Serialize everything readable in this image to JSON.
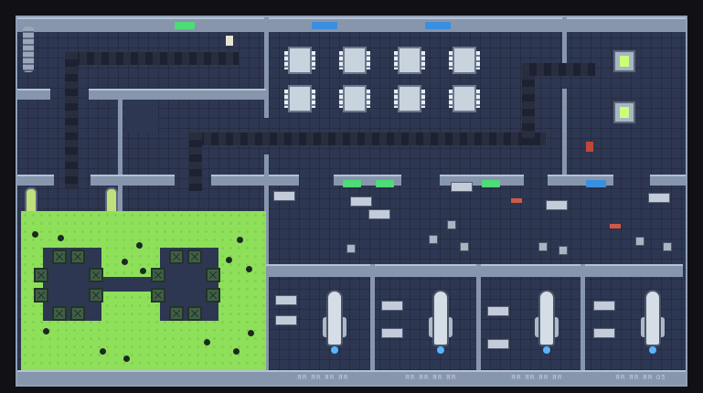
{
  "game": {
    "view": "top-down space station map",
    "signs": {
      "green_color": "#4ddc78",
      "blue_color": "#3a8fe0"
    },
    "bottom_labels": [
      "ЯR ЯR ЯR ЯR",
      "ЯR ЯR ЯR ЯR",
      "ЯR ЯR ЯR ЯR",
      "ЯR ЯR ЯR 05"
    ],
    "rooms": [
      "mess-hall",
      "corridor",
      "greenhouse",
      "office",
      "hangar-bay-1",
      "hangar-bay-2",
      "hangar-bay-3",
      "hangar-bay-4"
    ],
    "colors": {
      "floor": "#2e3752",
      "wall": "#8796ad",
      "grass": "#8ee05a",
      "engine_glow": "#58b4ff"
    }
  }
}
